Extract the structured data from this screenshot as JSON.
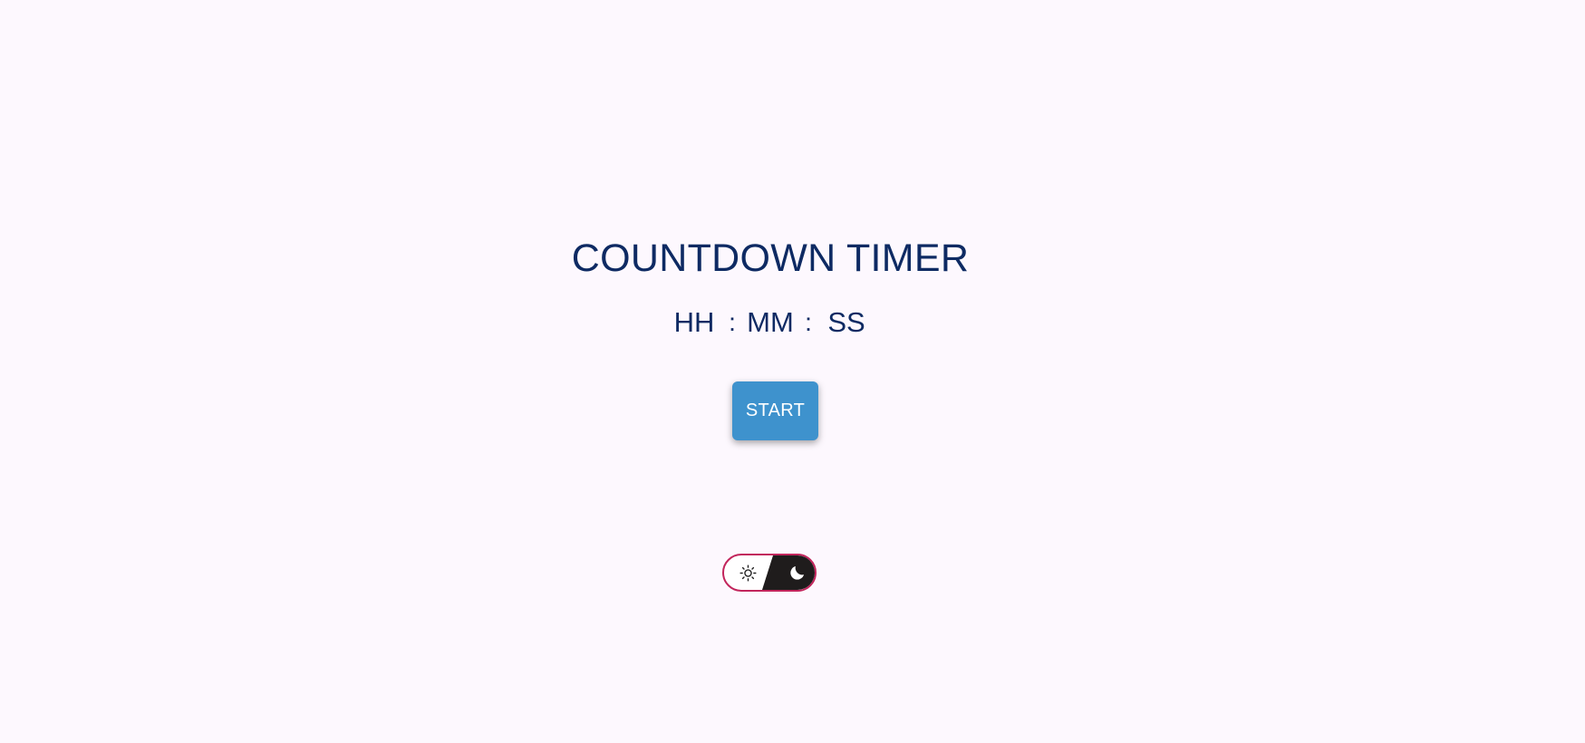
{
  "header": {
    "title": "COUNTDOWN TIMER"
  },
  "timer": {
    "hours_placeholder": "HH",
    "minutes_placeholder": "MM",
    "seconds_placeholder": "SS",
    "separator": ":"
  },
  "controls": {
    "start_label": "START"
  },
  "theme_toggle": {
    "light_icon": "sun-icon",
    "dark_icon": "moon-icon",
    "state": "dark",
    "border_color": "#c2255c",
    "dark_color": "#1f1c1c"
  },
  "colors": {
    "background": "#fdf8fe",
    "title": "#0e2a63",
    "button": "#3e92cd"
  }
}
